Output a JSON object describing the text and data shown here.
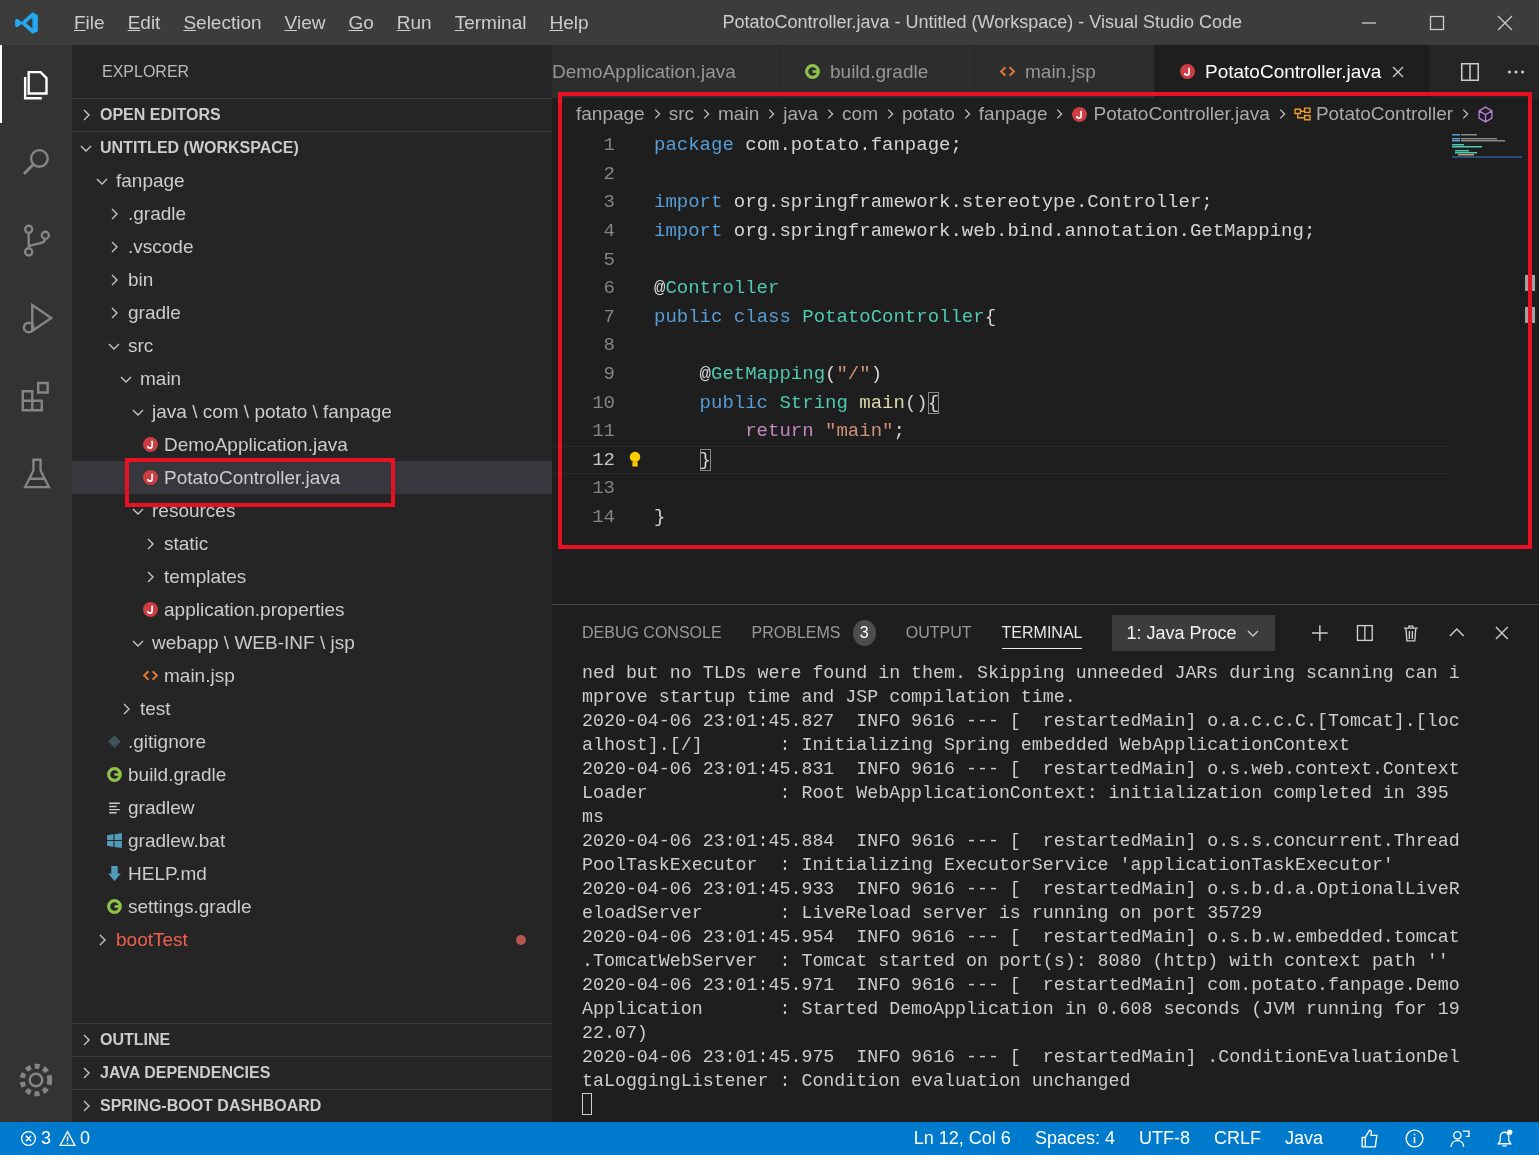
{
  "window": {
    "title": "PotatoController.java - Untitled (Workspace) - Visual Studio Code"
  },
  "menu": [
    "File",
    "Edit",
    "Selection",
    "View",
    "Go",
    "Run",
    "Terminal",
    "Help"
  ],
  "activity_bar": [
    {
      "kind": "explorer",
      "selected": true
    },
    {
      "kind": "search",
      "selected": false
    },
    {
      "kind": "source-control",
      "selected": false
    },
    {
      "kind": "debug",
      "selected": false
    },
    {
      "kind": "extensions",
      "selected": false
    },
    {
      "kind": "testing",
      "selected": false
    }
  ],
  "sidebar": {
    "title": "EXPLORER",
    "sections": [
      {
        "title": "OPEN EDITORS",
        "expanded": false
      },
      {
        "title": "UNTITLED (WORKSPACE)",
        "expanded": true,
        "tree": [
          {
            "label": "fanpage",
            "kind": "folder",
            "expanded": true,
            "selected": false,
            "error": false,
            "children": [
              {
                "label": ".gradle",
                "kind": "folder",
                "expanded": false,
                "selected": false,
                "error": false
              },
              {
                "label": ".vscode",
                "kind": "folder",
                "expanded": false,
                "selected": false,
                "error": false
              },
              {
                "label": "bin",
                "kind": "folder",
                "expanded": false,
                "selected": false,
                "error": false
              },
              {
                "label": "gradle",
                "kind": "folder",
                "expanded": false,
                "selected": false,
                "error": false
              },
              {
                "label": "src",
                "kind": "folder",
                "expanded": true,
                "selected": false,
                "error": false,
                "children": [
                  {
                    "label": "main",
                    "kind": "folder",
                    "expanded": true,
                    "selected": false,
                    "error": false,
                    "children": [
                      {
                        "label": "java \\ com \\ potato \\ fanpage",
                        "kind": "folder",
                        "expanded": true,
                        "selected": false,
                        "error": false,
                        "children": [
                          {
                            "label": "DemoApplication.java",
                            "kind": "java",
                            "selected": false,
                            "error": false
                          },
                          {
                            "label": "PotatoController.java",
                            "kind": "java",
                            "selected": true,
                            "error": false
                          }
                        ]
                      },
                      {
                        "label": "resources",
                        "kind": "folder",
                        "expanded": true,
                        "selected": false,
                        "error": false,
                        "children": [
                          {
                            "label": "static",
                            "kind": "folder",
                            "expanded": false,
                            "selected": false,
                            "error": false
                          },
                          {
                            "label": "templates",
                            "kind": "folder",
                            "expanded": false,
                            "selected": false,
                            "error": false
                          },
                          {
                            "label": "application.properties",
                            "kind": "properties",
                            "selected": false,
                            "error": false
                          }
                        ]
                      },
                      {
                        "label": "webapp \\ WEB-INF \\ jsp",
                        "kind": "folder",
                        "expanded": true,
                        "selected": false,
                        "error": false,
                        "children": [
                          {
                            "label": "main.jsp",
                            "kind": "jsp",
                            "selected": false,
                            "error": false
                          }
                        ]
                      }
                    ]
                  },
                  {
                    "label": "test",
                    "kind": "folder",
                    "expanded": false,
                    "selected": false,
                    "error": false
                  }
                ]
              },
              {
                "label": ".gitignore",
                "kind": "git",
                "selected": false,
                "error": false
              },
              {
                "label": "build.gradle",
                "kind": "gradle",
                "selected": false,
                "error": false
              },
              {
                "label": "gradlew",
                "kind": "script",
                "selected": false,
                "error": false
              },
              {
                "label": "gradlew.bat",
                "kind": "windows",
                "selected": false,
                "error": false
              },
              {
                "label": "HELP.md",
                "kind": "markdown",
                "selected": false,
                "error": false
              },
              {
                "label": "settings.gradle",
                "kind": "gradle",
                "selected": false,
                "error": false
              }
            ]
          },
          {
            "label": "bootTest",
            "kind": "folder",
            "expanded": false,
            "selected": false,
            "error": true
          }
        ]
      },
      {
        "title": "OUTLINE",
        "expanded": false
      },
      {
        "title": "JAVA DEPENDENCIES",
        "expanded": false
      },
      {
        "title": "SPRING-BOOT DASHBOARD",
        "expanded": false
      }
    ]
  },
  "tabs": [
    {
      "label": "DemoApplication.java",
      "selected": false
    },
    {
      "label": "build.gradle",
      "kind": "gradle",
      "selected": false
    },
    {
      "label": "main.jsp",
      "kind": "jsp",
      "selected": false
    },
    {
      "label": "PotatoController.java",
      "kind": "java",
      "selected": true
    }
  ],
  "breadcrumb": [
    {
      "text": "fanpage",
      "kind": "folder"
    },
    {
      "text": "src",
      "kind": "folder"
    },
    {
      "text": "main",
      "kind": "folder"
    },
    {
      "text": "java",
      "kind": "folder"
    },
    {
      "text": "com",
      "kind": "folder"
    },
    {
      "text": "potato",
      "kind": "folder"
    },
    {
      "text": "fanpage",
      "kind": "folder"
    },
    {
      "text": "PotatoController.java",
      "kind": "java"
    },
    {
      "text": "PotatoController",
      "kind": "class"
    }
  ],
  "code": [
    {
      "number": "1",
      "current": false,
      "tokens": [
        {
          "kind": "keyword",
          "text": "package"
        },
        {
          "kind": "plain",
          "text": " com.potato.fanpage;"
        }
      ]
    },
    {
      "number": "2",
      "current": false
    },
    {
      "number": "3",
      "current": false,
      "tokens": [
        {
          "kind": "keyword",
          "text": "import"
        },
        {
          "kind": "plain",
          "text": " org.springframework.stereotype.Controller;"
        }
      ]
    },
    {
      "number": "4",
      "current": false,
      "tokens": [
        {
          "kind": "keyword",
          "text": "import"
        },
        {
          "kind": "plain",
          "text": " org.springframework.web.bind.annotation.GetMapping;"
        }
      ]
    },
    {
      "number": "5",
      "current": false
    },
    {
      "number": "6",
      "current": false,
      "tokens": [
        {
          "kind": "plain",
          "text": "@"
        },
        {
          "kind": "type",
          "text": "Controller"
        }
      ]
    },
    {
      "number": "7",
      "current": false,
      "tokens": [
        {
          "kind": "keyword",
          "text": "public"
        },
        {
          "kind": "keyword",
          "text": " class"
        },
        {
          "kind": "type",
          "text": " PotatoController"
        },
        {
          "kind": "plain",
          "text": "{"
        }
      ]
    },
    {
      "number": "8",
      "current": false
    },
    {
      "number": "9",
      "current": false,
      "tokens": [
        {
          "kind": "plain",
          "text": "    @"
        },
        {
          "kind": "type",
          "text": "GetMapping"
        },
        {
          "kind": "plain",
          "text": "("
        },
        {
          "kind": "string",
          "text": "\"/\""
        },
        {
          "kind": "plain",
          "text": ")"
        }
      ]
    },
    {
      "number": "10",
      "current": false,
      "tokens": [
        {
          "kind": "keyword",
          "text": "    public"
        },
        {
          "kind": "type",
          "text": " String"
        },
        {
          "kind": "function",
          "text": " main"
        },
        {
          "kind": "plain",
          "text": "()"
        },
        {
          "kind": "bracket",
          "text": "{"
        }
      ]
    },
    {
      "number": "11",
      "current": false,
      "tokens": [
        {
          "kind": "control",
          "text": "        return"
        },
        {
          "kind": "string",
          "text": " \"main\""
        },
        {
          "kind": "plain",
          "text": ";"
        }
      ]
    },
    {
      "number": "12",
      "current": true,
      "tokens": [
        {
          "kind": "bracket",
          "text": "    }"
        }
      ]
    },
    {
      "number": "13",
      "current": false
    },
    {
      "number": "14",
      "current": false,
      "tokens": [
        {
          "kind": "plain",
          "text": "}"
        }
      ]
    }
  ],
  "panel": {
    "tabs": [
      {
        "label": "DEBUG CONSOLE",
        "selected": false
      },
      {
        "label": "PROBLEMS",
        "count": "3",
        "selected": false
      },
      {
        "label": "OUTPUT",
        "selected": false
      },
      {
        "label": "TERMINAL",
        "selected": true
      }
    ],
    "terminal_select": "1: Java Proce",
    "terminal_lines": [
      "ned but no TLDs were found in them. Skipping unneeded JARs during scanning can i",
      "mprove startup time and JSP compilation time.",
      "2020-04-06 23:01:45.827  INFO 9616 --- [  restartedMain] o.a.c.c.C.[Tomcat].[loc",
      "alhost].[/]       : Initializing Spring embedded WebApplicationContext",
      "2020-04-06 23:01:45.831  INFO 9616 --- [  restartedMain] o.s.web.context.Context",
      "Loader            : Root WebApplicationContext: initialization completed in 395",
      "ms",
      "2020-04-06 23:01:45.884  INFO 9616 --- [  restartedMain] o.s.s.concurrent.Thread",
      "PoolTaskExecutor  : Initializing ExecutorService 'applicationTaskExecutor'",
      "2020-04-06 23:01:45.933  INFO 9616 --- [  restartedMain] o.s.b.d.a.OptionalLiveR",
      "eloadServer       : LiveReload server is running on port 35729",
      "2020-04-06 23:01:45.954  INFO 9616 --- [  restartedMain] o.s.b.w.embedded.tomcat",
      ".TomcatWebServer  : Tomcat started on port(s): 8080 (http) with context path ''",
      "2020-04-06 23:01:45.971  INFO 9616 --- [  restartedMain] com.potato.fanpage.Demo",
      "Application       : Started DemoApplication in 0.608 seconds (JVM running for 19",
      "22.07)",
      "2020-04-06 23:01:45.975  INFO 9616 --- [  restartedMain] .ConditionEvaluationDel",
      "taLoggingListener : Condition evaluation unchanged"
    ]
  },
  "status_bar": {
    "left": [
      {
        "kind": "errors",
        "text": "3"
      },
      {
        "kind": "warnings",
        "text": "0"
      }
    ],
    "right": [
      "Ln 12, Col 6",
      "Spaces: 4",
      "UTF-8",
      "CRLF",
      "Java"
    ]
  }
}
